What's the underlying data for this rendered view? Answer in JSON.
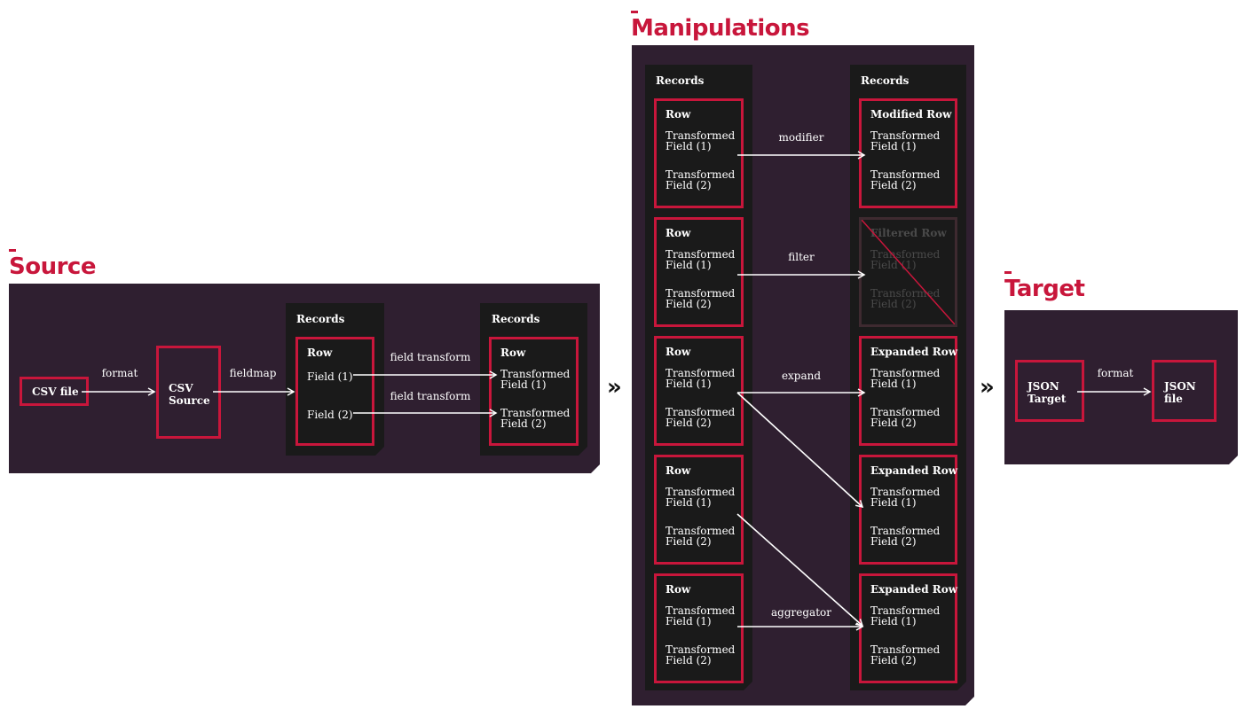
{
  "sections": {
    "source": "Source",
    "manipulations": "Manipulations",
    "target": "Target"
  },
  "source": {
    "csv_file": "CSV file",
    "csv_source_line1": "CSV",
    "csv_source_line2": "Source",
    "records_label_1": "Records",
    "records_label_2": "Records",
    "row_title_1": "Row",
    "row_title_2": "Row",
    "field_1": "Field (1)",
    "field_2": "Field (2)",
    "tfield_1": "Transformed Field (1)",
    "tfield_2": "Transformed Field (2)",
    "arrow_format": "format",
    "arrow_fieldmap": "fieldmap",
    "arrow_ft1": "field transform",
    "arrow_ft2": "field transform"
  },
  "manipulations": {
    "records_left": "Records",
    "records_right": "Records",
    "left_rows": [
      {
        "title": "Row",
        "f1": "Transformed Field (1)",
        "f2": "Transformed Field (2)"
      },
      {
        "title": "Row",
        "f1": "Transformed Field (1)",
        "f2": "Transformed Field (2)"
      },
      {
        "title": "Row",
        "f1": "Transformed Field (1)",
        "f2": "Transformed Field (2)"
      },
      {
        "title": "Row",
        "f1": "Transformed Field (1)",
        "f2": "Transformed Field (2)"
      },
      {
        "title": "Row",
        "f1": "Transformed Field (1)",
        "f2": "Transformed Field (2)"
      }
    ],
    "right_rows": [
      {
        "title": "Modified Row",
        "f1": "Transformed Field (1)",
        "f2": "Transformed Field (2)"
      },
      {
        "title": "Filtered Row",
        "f1": "Transformed Field (1)",
        "f2": "Transformed Field (2)"
      },
      {
        "title": "Expanded Row",
        "f1": "Transformed Field (1)",
        "f2": "Transformed Field (2)"
      },
      {
        "title": "Expanded Row",
        "f1": "Transformed Field (1)",
        "f2": "Transformed Field (2)"
      },
      {
        "title": "Expanded Row",
        "f1": "Transformed Field (1)",
        "f2": "Transformed Field (2)"
      }
    ],
    "arrow_labels": {
      "modifier": "modifier",
      "filter": "filter",
      "expand": "expand",
      "aggregator": "aggregator"
    }
  },
  "target": {
    "json_target_line1": "JSON",
    "json_target_line2": "Target",
    "json_file_line1": "JSON",
    "json_file_line2": "file",
    "arrow_format": "format"
  },
  "chevron": "»",
  "colors": {
    "accent": "#c8163b",
    "panel": "#2f1f30",
    "records": "#1a1a1a",
    "text": "#ffffff"
  }
}
